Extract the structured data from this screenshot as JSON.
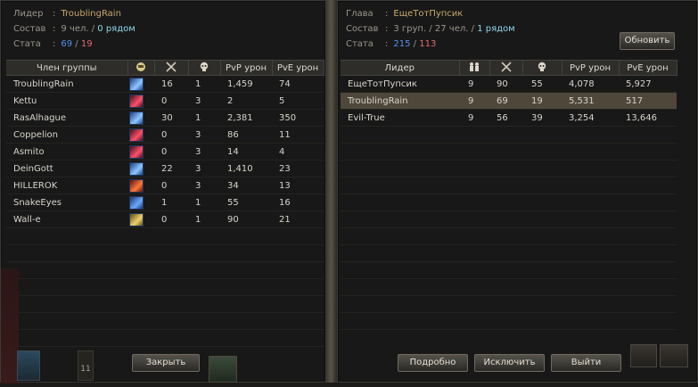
{
  "left": {
    "info": {
      "leader_label": "Лидер",
      "leader_name": "TroublingRain",
      "composition_label": "Состав",
      "members_count": "9 чел.",
      "separator": "/",
      "nearby_count": "0 рядом",
      "stats_label": "Стата",
      "stat_kills": "69",
      "stat_deaths": "19"
    },
    "headers": [
      "Член группы",
      "PvP урон",
      "PvE урон"
    ],
    "icon_header_names": [
      "class-icon",
      "kills-icon",
      "deaths-icon"
    ],
    "rows": [
      {
        "name": "TroublingRain",
        "kills": "16",
        "deaths": "1",
        "pvp": "1,459",
        "pve": "74",
        "cls": "blue-swords"
      },
      {
        "name": "Kettu",
        "kills": "0",
        "deaths": "3",
        "pvp": "2",
        "pve": "5",
        "cls": "red-archer"
      },
      {
        "name": "RasAlhague",
        "kills": "30",
        "deaths": "1",
        "pvp": "2,381",
        "pve": "350",
        "cls": "blue-swords"
      },
      {
        "name": "Coppelion",
        "kills": "0",
        "deaths": "3",
        "pvp": "86",
        "pve": "11",
        "cls": "red-archer"
      },
      {
        "name": "Asmito",
        "kills": "0",
        "deaths": "3",
        "pvp": "14",
        "pve": "4",
        "cls": "red-archer"
      },
      {
        "name": "DeinGott",
        "kills": "22",
        "deaths": "3",
        "pvp": "1,410",
        "pve": "23",
        "cls": "blue-swords"
      },
      {
        "name": "HILLEROK",
        "kills": "0",
        "deaths": "3",
        "pvp": "34",
        "pve": "13",
        "cls": "red-fire"
      },
      {
        "name": "SnakeEyes",
        "kills": "1",
        "deaths": "1",
        "pvp": "55",
        "pve": "16",
        "cls": "blue-staff"
      },
      {
        "name": "Wall-e",
        "kills": "0",
        "deaths": "1",
        "pvp": "90",
        "pve": "21",
        "cls": "gold-shield"
      }
    ],
    "close_button": "Закрыть",
    "bottom_count": "11"
  },
  "right": {
    "info": {
      "chief_label": "Глава",
      "chief_name": "ЕщеТотПупсик",
      "composition_label": "Состав",
      "groups_count": "3 груп.",
      "members_count": "27 чел.",
      "separator": "/",
      "nearby_count": "1 рядом",
      "stats_label": "Стата",
      "stat_kills": "215",
      "stat_deaths": "113"
    },
    "refresh_button": "Обновить",
    "headers": [
      "Лидер",
      "PvP урон",
      "PvE урон"
    ],
    "icon_header_names": [
      "members-icon",
      "kills-icon",
      "deaths-icon"
    ],
    "rows": [
      {
        "name": "ЕщеТотПупсик",
        "members": "9",
        "kills": "90",
        "deaths": "55",
        "pvp": "4,078",
        "pve": "5,927"
      },
      {
        "name": "TroublingRain",
        "members": "9",
        "kills": "69",
        "deaths": "19",
        "pvp": "5,531",
        "pve": "517"
      },
      {
        "name": "Evil-True",
        "members": "9",
        "kills": "56",
        "deaths": "39",
        "pvp": "3,254",
        "pve": "13,646"
      }
    ],
    "selected_row": 1,
    "buttons": [
      "Подробно",
      "Исключить",
      "Выйти"
    ]
  },
  "colors": {
    "leader_name": "#c8a769",
    "nearby": "#8fd6ec",
    "kills": "#5b8ef0",
    "deaths": "#e06b6b",
    "selected_row": "#4f473a"
  }
}
